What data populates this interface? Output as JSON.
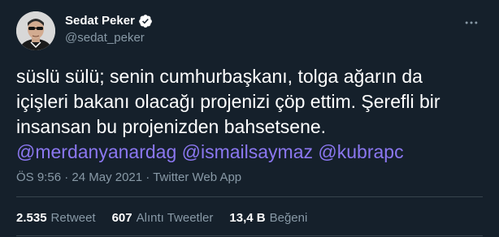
{
  "author": {
    "name": "Sedat Peker",
    "handle": "@sedat_peker",
    "verified": true
  },
  "tweet": {
    "text_plain": "süslü sülü; senin cumhurbaşkanı, tolga ağarın da içişleri bakanı olacağı projenizi çöp ettim. Şerefli bir insansan bu projenizden bahsetsene.",
    "mentions": [
      "@merdanyanardag",
      "@ismailsaymaz",
      "@kubrapc"
    ]
  },
  "meta": {
    "time": "ÖS 9:56",
    "date": "24 May 2021",
    "source": "Twitter Web App",
    "separator": "·"
  },
  "stats": {
    "retweets": {
      "count": "2.535",
      "label": "Retweet"
    },
    "quotes": {
      "count": "607",
      "label": "Alıntı Tweetler"
    },
    "likes": {
      "count": "13,4 B",
      "label": "Beğeni"
    }
  },
  "colors": {
    "background": "#15202b",
    "mention": "#8b77f0",
    "secondary_text": "#8899a6",
    "verified_badge": "#ffffff",
    "divider": "#38444d"
  },
  "icons": {
    "verified": "verified-badge-icon",
    "more": "more-options-icon"
  }
}
